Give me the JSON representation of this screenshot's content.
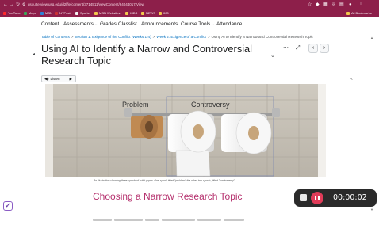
{
  "browser": {
    "url": "gsoutte.view.usg.edu/d2l/le/content/3714511/viewContent/64044017/View",
    "bookmarks": [
      {
        "label": "YouTube",
        "color": "#ff2a2a"
      },
      {
        "label": "Maps",
        "color": "#3aa757"
      },
      {
        "label": "MSN",
        "color": "#2b82d8"
      },
      {
        "label": "NYPost",
        "color": "#cc3333"
      },
      {
        "label": "Sports",
        "color": "#f2f2f2"
      },
      {
        "label": "MSN Websites",
        "color": "#f2c94c"
      },
      {
        "label": "KIDS",
        "color": "#f2c94c"
      },
      {
        "label": "NEWS",
        "color": "#f2c94c"
      },
      {
        "label": "000",
        "color": "#f2c94c"
      }
    ],
    "all_bookmarks": "All Bookmarks"
  },
  "navbar": {
    "items": [
      "Content",
      "Assessments",
      "Grades",
      "Classlist",
      "Announcements",
      "Course Tools",
      "Attendance"
    ]
  },
  "breadcrumb": {
    "items": [
      "Table of Contents",
      "Section 1: Exigence of the Conflict (Weeks 1-4)",
      "Week 2: Exigence of a Conflict"
    ],
    "current": "Using AI to Identify a Narrow and Controversial Research Topic"
  },
  "page": {
    "title": "Using AI to Identify a Narrow and Controversial Research Topic",
    "listen_label": "Listen",
    "image_labels": {
      "left": "Problem",
      "right": "Controversy"
    },
    "caption": "An illustration showing three spools of toilet paper. One spool, titled \"problem\" the other two spools, titled \"controversy\"",
    "section_heading": "Choosing a Narrow Research Topic"
  },
  "recorder": {
    "elapsed": "00:00:02",
    "accent": "#e03b58"
  },
  "colors": {
    "chrome": "#8d1f4a",
    "heading_accent": "#b5306d",
    "link": "#006fbf"
  }
}
